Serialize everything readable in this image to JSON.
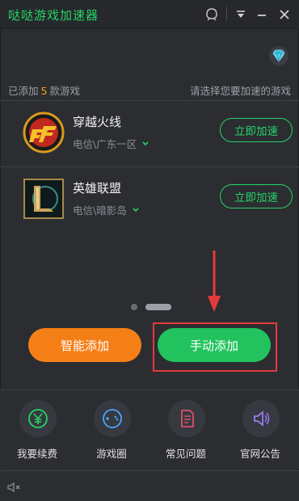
{
  "app": {
    "title": "哒哒游戏加速器"
  },
  "titlebar": {
    "icons": [
      "skin-icon",
      "menu-icon",
      "minimize-icon",
      "close-icon"
    ]
  },
  "summary": {
    "prefix": "已添加",
    "count": "5",
    "suffix": "款游戏",
    "hint": "请选择您要加速的游戏"
  },
  "games": [
    {
      "name": "穿越火线",
      "server": "电信\\广东一区",
      "button": "立即加速",
      "logo": "crossfire-logo"
    },
    {
      "name": "英雄联盟",
      "server": "电信\\暗影岛",
      "button": "立即加速",
      "logo": "lol-logo"
    }
  ],
  "pager": {
    "pages": 2,
    "active": 1
  },
  "actions": {
    "smart_add": "智能添加",
    "manual_add": "手动添加"
  },
  "nav": [
    {
      "label": "我要续费",
      "icon": "yuan-icon"
    },
    {
      "label": "游戏圈",
      "icon": "gamepad-icon"
    },
    {
      "label": "常见问题",
      "icon": "document-icon"
    },
    {
      "label": "官网公告",
      "icon": "speaker-icon"
    }
  ],
  "colors": {
    "accent": "#25d366",
    "orange": "#f57f17",
    "highlight": "#e23b3b",
    "count": "#f4a21c"
  }
}
